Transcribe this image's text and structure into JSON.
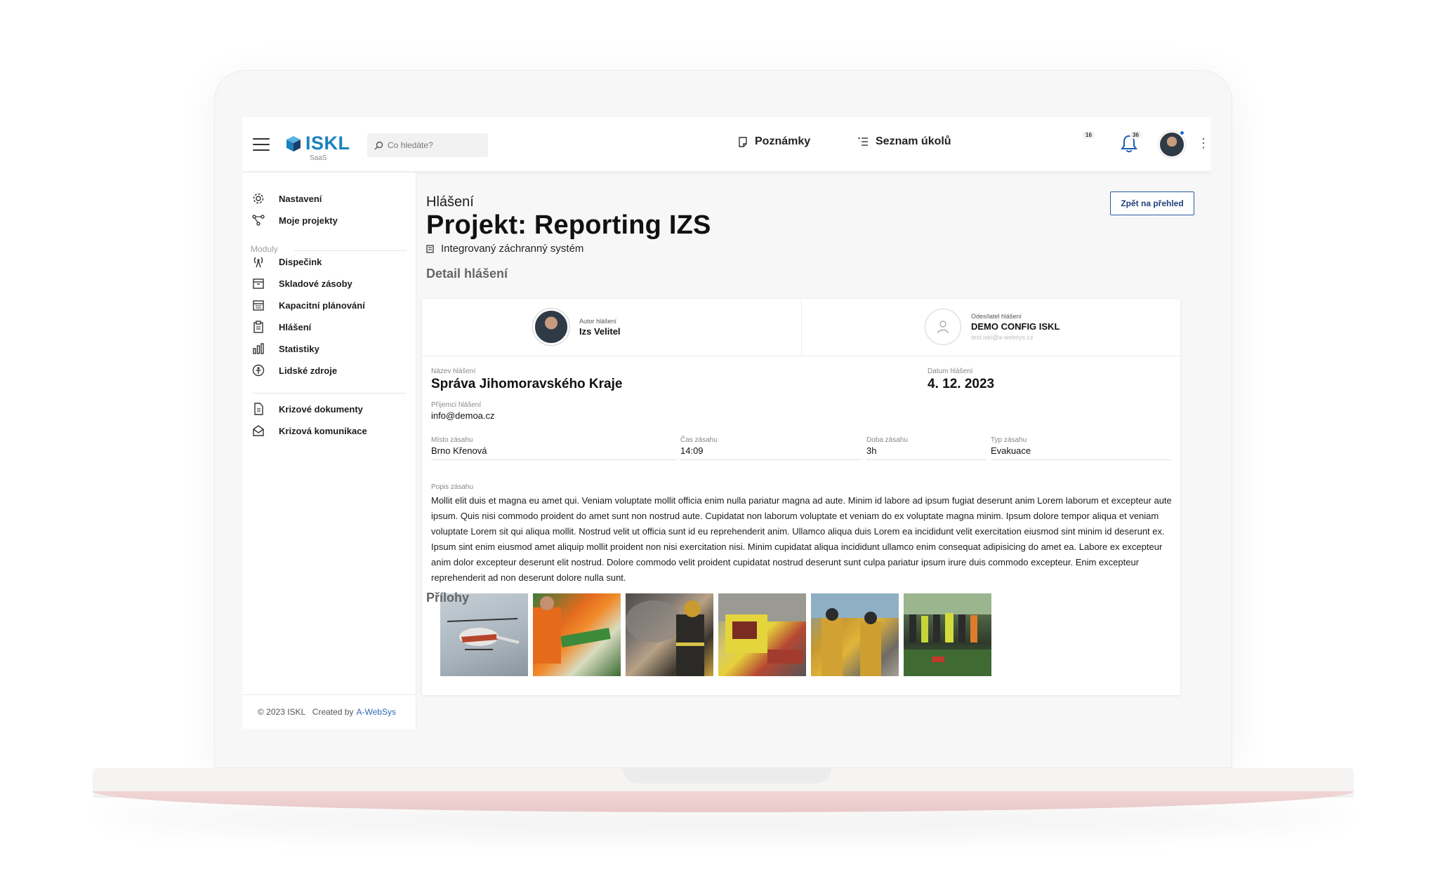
{
  "app": {
    "name": "ISKL",
    "sub": "SaaS"
  },
  "search": {
    "placeholder": "Co hledáte?"
  },
  "topbar": {
    "notes_label": "Poznámky",
    "tasks_label": "Seznam úkolů",
    "tasks_count": "16",
    "notifications_count": "36"
  },
  "sidebar": {
    "items": [
      {
        "label": "Nastavení",
        "icon": "gear-icon"
      },
      {
        "label": "Moje projekty",
        "icon": "network-icon"
      }
    ],
    "section_label": "Moduly",
    "modules": [
      {
        "label": "Dispečink",
        "icon": "antenna-icon"
      },
      {
        "label": "Skladové zásoby",
        "icon": "box-icon"
      },
      {
        "label": "Kapacitní plánování",
        "icon": "calendar-icon"
      },
      {
        "label": "Hlášení",
        "icon": "clipboard-icon"
      },
      {
        "label": "Statistiky",
        "icon": "bar-chart-icon"
      },
      {
        "label": "Lidské zdroje",
        "icon": "person-circle-icon"
      }
    ],
    "extra": [
      {
        "label": "Krizové dokumenty",
        "icon": "document-icon"
      },
      {
        "label": "Krizová komunikace",
        "icon": "mail-open-icon"
      }
    ],
    "footer_copy": "© 2023 ISKL   Created by",
    "footer_link": "A-WebSys"
  },
  "page": {
    "kicker": "Hlášení",
    "title": "Projekt: Reporting IZS",
    "subtitle": "Integrovaný záchranný systém",
    "back_button": "Zpět na přehled",
    "section_detail": "Detail hlášení",
    "section_attachments": "Přílohy"
  },
  "report": {
    "author_label": "Autor hlášení",
    "author_name": "Izs Velitel",
    "sender_label": "Odesílatel hlášení",
    "sender_name": "DEMO CONFIG ISKL",
    "sender_email": "test.iskl@a-websys.cz",
    "name_label": "Název hlášení",
    "name_value": "Správa Jihomoravského Kraje",
    "date_label": "Datum hlášení",
    "date_value": "4. 12. 2023",
    "recipients_label": "Příjemci hlášení",
    "recipients_value": "info@demoa.cz",
    "place_label": "Místo zásahu",
    "place_value": "Brno Křenová",
    "time_label": "Čas zásahu",
    "time_value": "14:09",
    "duration_label": "Doba zásahu",
    "duration_value": "3h",
    "type_label": "Typ zásahu",
    "type_value": "Evakuace",
    "description_label": "Popis zásahu",
    "description": "Mollit elit duis et magna eu amet qui. Veniam voluptate mollit officia enim nulla pariatur magna ad aute. Minim id labore ad ipsum fugiat deserunt anim Lorem laborum et excepteur aute ipsum. Quis nisi commodo proident do amet sunt non nostrud aute. Cupidatat non laborum voluptate et veniam do ex voluptate magna minim. Ipsum dolore tempor aliqua et veniam voluptate Lorem sit qui aliqua mollit. Nostrud velit ut officia sunt id eu reprehenderit anim. Ullamco aliqua duis Lorem ea incididunt velit exercitation eiusmod sint minim id deserunt ex. Ipsum sint enim eiusmod amet aliquip mollit proident non nisi exercitation nisi. Minim cupidatat aliqua incididunt ullamco enim consequat adipisicing do amet ea. Labore ex excepteur anim dolor excepteur deserunt elit nostrud. Dolore commodo velit proident cupidatat nostrud deserunt sunt culpa pariatur ipsum irure duis commodo excepteur. Enim excepteur reprehenderit ad non deserunt dolore nulla sunt.",
    "photos": [
      "helicopter-photo",
      "stretcher-rescue-photo",
      "firefighter-smoke-photo",
      "ambulance-photo",
      "firefighters-walking-photo",
      "rescue-team-photo"
    ]
  }
}
